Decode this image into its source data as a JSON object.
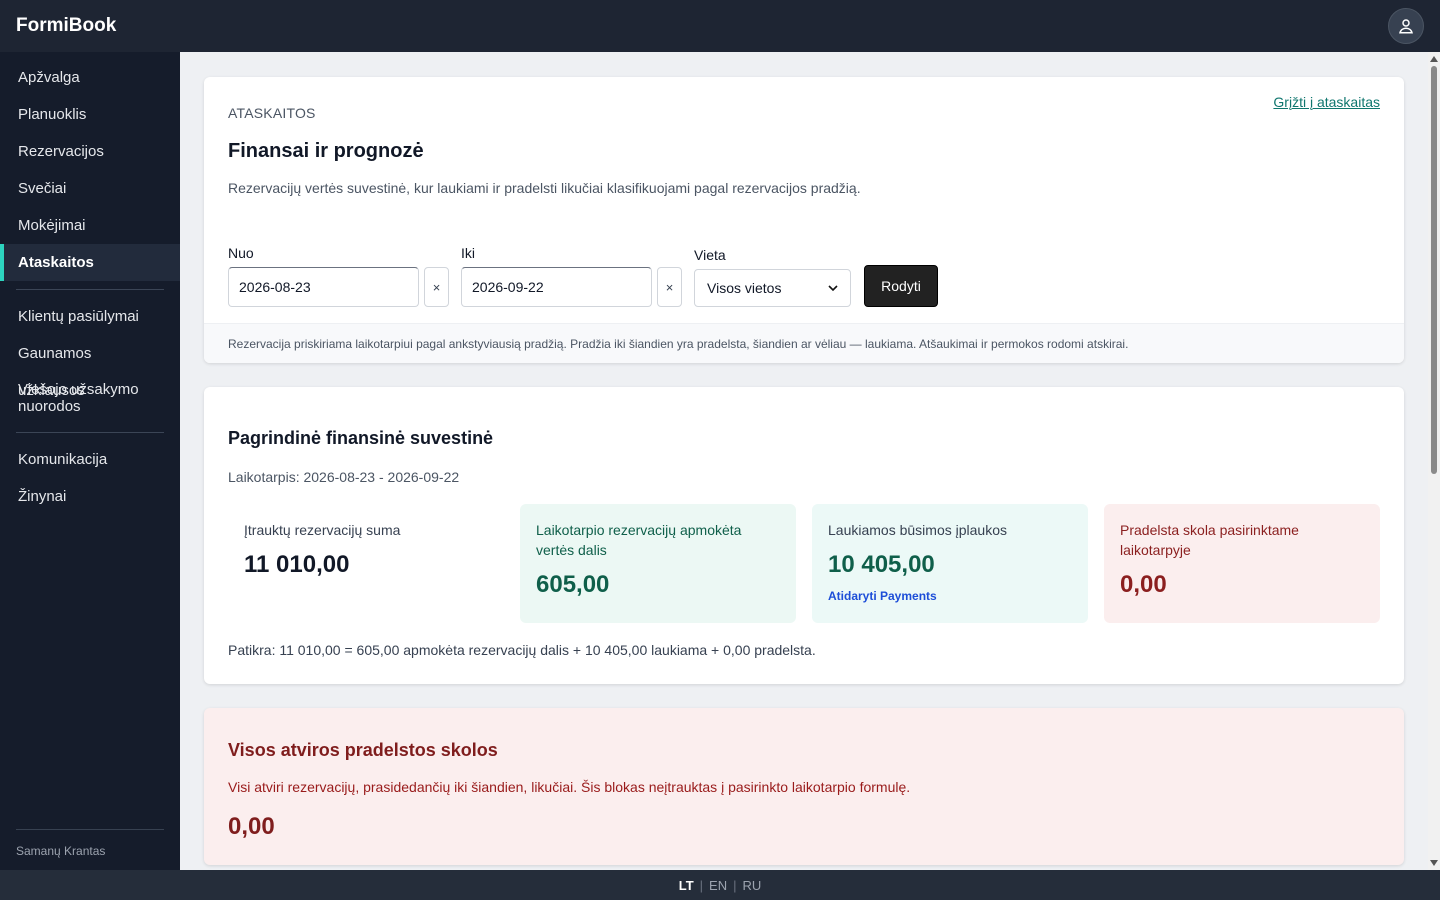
{
  "app": {
    "brand": "FormiBook"
  },
  "sidebar": {
    "items": [
      {
        "label": "Apžvalga"
      },
      {
        "label": "Planuoklis"
      },
      {
        "label": "Rezervacijos"
      },
      {
        "label": "Svečiai"
      },
      {
        "label": "Mokėjimai"
      },
      {
        "label": "Ataskaitos",
        "active": true
      },
      {
        "label": "Klientų pasiūlymai"
      },
      {
        "label": "Gaunamos užklausos"
      },
      {
        "label": "Viešojo užsakymo nuorodos"
      },
      {
        "label": "Komunikacija"
      },
      {
        "label": "Žinynai"
      }
    ],
    "footer": "Samanų Krantas"
  },
  "header": {
    "eyebrow": "ATASKAITOS",
    "title": "Finansai ir prognozė",
    "description": "Rezervacijų vertės suvestinė, kur laukiami ir pradelsti likučiai klasifikuojami pagal rezervacijos pradžią.",
    "back_link": "Grįžti į ataskaitas"
  },
  "filters": {
    "from_label": "Nuo",
    "from_value": "2026-08-23",
    "to_label": "Iki",
    "to_value": "2026-09-22",
    "clear_symbol": "×",
    "venue_label": "Vieta",
    "venue_value": "Visos vietos",
    "show_button": "Rodyti",
    "note": "Rezervacija priskiriama laikotarpiui pagal ankstyviausią pradžią. Pradžia iki šiandien yra pradelsta, šiandien ar vėliau — laukiama. Atšaukimai ir permokos rodomi atskirai."
  },
  "summary": {
    "title": "Pagrindinė finansinė suvestinė",
    "period": "Laikotarpis: 2026-08-23 - 2026-09-22",
    "kpis": [
      {
        "label": "Įtrauktų rezervacijų suma",
        "value": "11 010,00"
      },
      {
        "label": "Laikotarpio rezervacijų apmokėta vertės dalis",
        "value": "605,00"
      },
      {
        "label": "Laukiamos būsimos įplaukos",
        "value": "10 405,00",
        "link": "Atidaryti Payments"
      },
      {
        "label": "Pradelsta skola pasirinktame laikotarpyje",
        "value": "0,00"
      }
    ],
    "check": "Patikra: 11 010,00 = 605,00 apmokėta rezervacijų dalis + 10 405,00 laukiama + 0,00 pradelsta."
  },
  "overdue": {
    "title": "Visos atviros pradelstos skolos",
    "description": "Visi atviri rezervacijų, prasidedančių iki šiandien, likučiai. Šis blokas neįtrauktas į pasirinkto laikotarpio formulę.",
    "value": "0,00"
  },
  "footer": {
    "languages": [
      "LT",
      "EN",
      "RU"
    ],
    "active_language": "LT"
  }
}
